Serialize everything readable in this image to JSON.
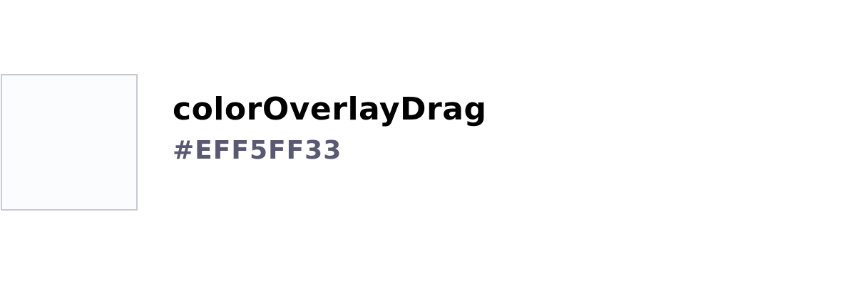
{
  "token": {
    "name": "colorOverlayDrag",
    "value": "#EFF5FF33",
    "swatch_color": "#fbfcfe",
    "swatch_border": "#c8cad2"
  },
  "colors": {
    "name_text": "#000000",
    "value_text": "#5b5873",
    "background": "#ffffff"
  }
}
